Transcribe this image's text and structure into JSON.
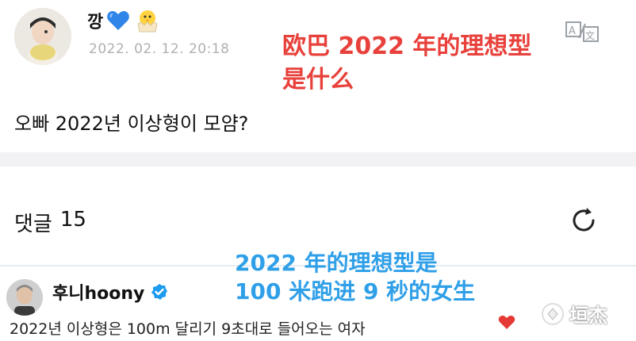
{
  "post": {
    "username": "깡",
    "timestamp": "2022. 02. 12. 20:18",
    "body": "오빠 2022년 이상형이 모얌?",
    "emojis": [
      "blue-heart",
      "hatching-chick"
    ],
    "translate_icon": "translate-icon"
  },
  "overlays": {
    "red_line1": "欧巴 2022 年的理想型",
    "red_line2": "是什么",
    "blue_line1": "2022 年的理想型是",
    "blue_line2": "100 米跑进 9 秒的女生"
  },
  "comments": {
    "label": "댓글",
    "count": "15",
    "refresh_icon": "refresh-icon",
    "items": [
      {
        "username": "후니hoony",
        "verified": true,
        "text": "2022년 이상형은 100m 달리기 9초대로 들어오는 여자"
      }
    ]
  },
  "watermark": {
    "text": "垣杰"
  },
  "colors": {
    "overlay_red": "#e8413b",
    "overlay_blue": "#2f9fe8",
    "divider": "#f2f2f4",
    "verified": "#1d9bf0"
  }
}
